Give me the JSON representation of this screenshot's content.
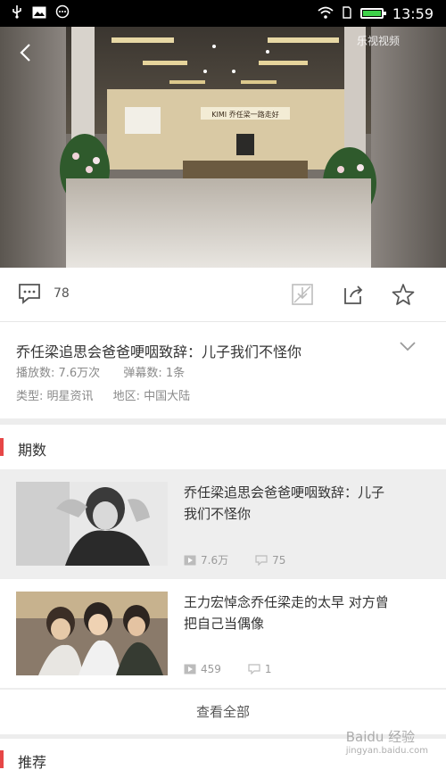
{
  "status_bar": {
    "time": "13:59",
    "left_icons": [
      "usb-icon",
      "image-icon",
      "message-icon"
    ],
    "right_icons": [
      "wifi-icon",
      "sim-icon",
      "battery-icon"
    ]
  },
  "player": {
    "brand_watermark": "乐视视频",
    "banner_text": "KIMI 乔任梁一路走好"
  },
  "actions": {
    "comment_count": "78",
    "icons": [
      "comment-icon",
      "download-icon",
      "share-icon",
      "favorite-icon"
    ]
  },
  "video_info": {
    "title": "乔任梁追思会爸爸哽咽致辞：儿子我们不怪你",
    "play_count": "播放数: 7.6万次",
    "danmaku_count": "弹幕数: 1条",
    "type": "类型: 明星资讯",
    "region": "地区: 中国大陆"
  },
  "episodes_section": {
    "title": "期数"
  },
  "episodes": [
    {
      "title_line1": "乔任梁追思会爸爸哽咽致辞：儿子",
      "title_line2": "我们不怪你",
      "plays": "7.6万",
      "comments": "75"
    },
    {
      "title_line1": "王力宏悼念乔任梁走的太早 对方曾",
      "title_line2": "把自己当偶像",
      "plays": "459",
      "comments": "1"
    }
  ],
  "view_all_label": "查看全部",
  "recommend_section": {
    "title": "推荐"
  },
  "site_watermark": {
    "line1": "Baidu 经验",
    "line2": "jingyan.baidu.com"
  },
  "colors": {
    "accent": "#e64646",
    "status_bar": "#000000",
    "battery": "#3fd24a"
  }
}
